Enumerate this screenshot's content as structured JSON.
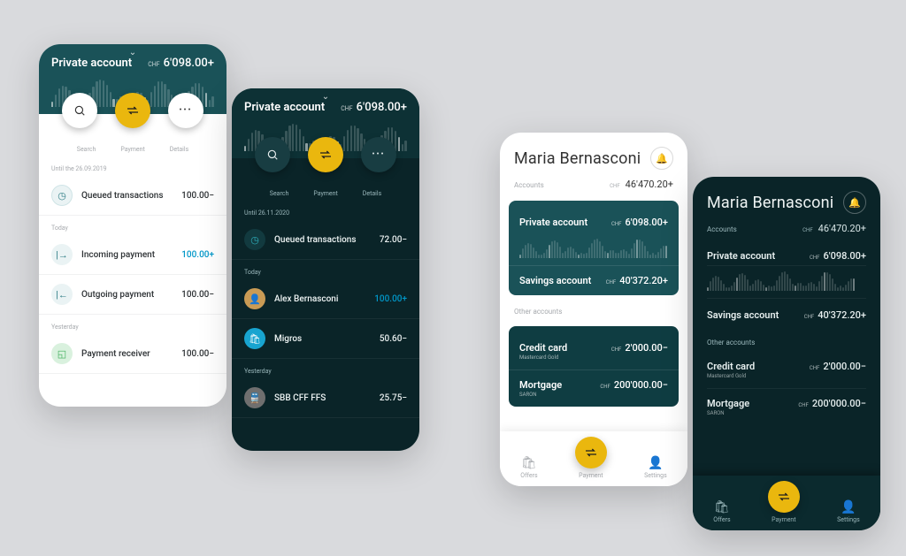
{
  "screen1": {
    "title": "Private account",
    "currency": "CHF",
    "balance": "6'098.00+",
    "actions": {
      "search": "Search",
      "payment": "Payment",
      "details": "Details"
    },
    "sections": [
      {
        "label": "Until the 26.09.2019",
        "rows": [
          {
            "icon": "queue",
            "label": "Queued transactions",
            "amount": "100.00−"
          }
        ]
      },
      {
        "label": "Today",
        "rows": [
          {
            "icon": "in",
            "label": "Incoming payment",
            "amount": "100.00+",
            "accent": true
          },
          {
            "icon": "out",
            "label": "Outgoing payment",
            "amount": "100.00−"
          }
        ]
      },
      {
        "label": "Yesterday",
        "rows": [
          {
            "icon": "receiver",
            "label": "Payment receiver",
            "amount": "100.00−"
          }
        ]
      }
    ]
  },
  "screen2": {
    "title": "Private account",
    "currency": "CHF",
    "balance": "6'098.00+",
    "actions": {
      "search": "Search",
      "payment": "Payment",
      "details": "Details"
    },
    "sections": [
      {
        "label": "Until 26.11.2020",
        "rows": [
          {
            "icon": "queue",
            "label": "Queued transactions",
            "amount": "72.00−"
          }
        ]
      },
      {
        "label": "Today",
        "rows": [
          {
            "icon": "avatar1",
            "label": "Alex Bernasconi",
            "amount": "100.00+",
            "accent": true
          },
          {
            "icon": "avatar2",
            "label": "Migros",
            "amount": "50.60−"
          }
        ]
      },
      {
        "label": "Yesterday",
        "rows": [
          {
            "icon": "sbb",
            "label": "SBB CFF FFS",
            "amount": "25.75−"
          }
        ]
      }
    ]
  },
  "screen3": {
    "name": "Maria Bernasconi",
    "accountsLabel": "Accounts",
    "currency": "CHF",
    "total": "46'470.20+",
    "main": [
      {
        "label": "Private account",
        "cur": "CHF",
        "val": "6'098.00+"
      },
      {
        "label": "Savings account",
        "cur": "CHF",
        "val": "40'372.20+"
      }
    ],
    "otherLabel": "Other accounts",
    "other": [
      {
        "label": "Credit card",
        "sub": "Mastercard Gold",
        "cur": "CHF",
        "val": "2'000.00−"
      },
      {
        "label": "Mortgage",
        "sub": "SARON",
        "cur": "CHF",
        "val": "200'000.00−"
      }
    ],
    "tabs": {
      "offers": "Offers",
      "payment": "Payment",
      "settings": "Settings"
    }
  },
  "screen4": {
    "name": "Maria Bernasconi",
    "accountsLabel": "Accounts",
    "currency": "CHF",
    "total": "46'470.20+",
    "main": [
      {
        "label": "Private account",
        "cur": "CHF",
        "val": "6'098.00+"
      },
      {
        "label": "Savings account",
        "cur": "CHF",
        "val": "40'372.20+"
      }
    ],
    "otherLabel": "Other accounts",
    "other": [
      {
        "label": "Credit card",
        "sub": "Mastercard Gold",
        "cur": "CHF",
        "val": "2'000.00−"
      },
      {
        "label": "Mortgage",
        "sub": "SARON",
        "cur": "CHF",
        "val": "200'000.00−"
      }
    ],
    "tabs": {
      "offers": "Offers",
      "payment": "Payment",
      "settings": "Settings"
    }
  }
}
